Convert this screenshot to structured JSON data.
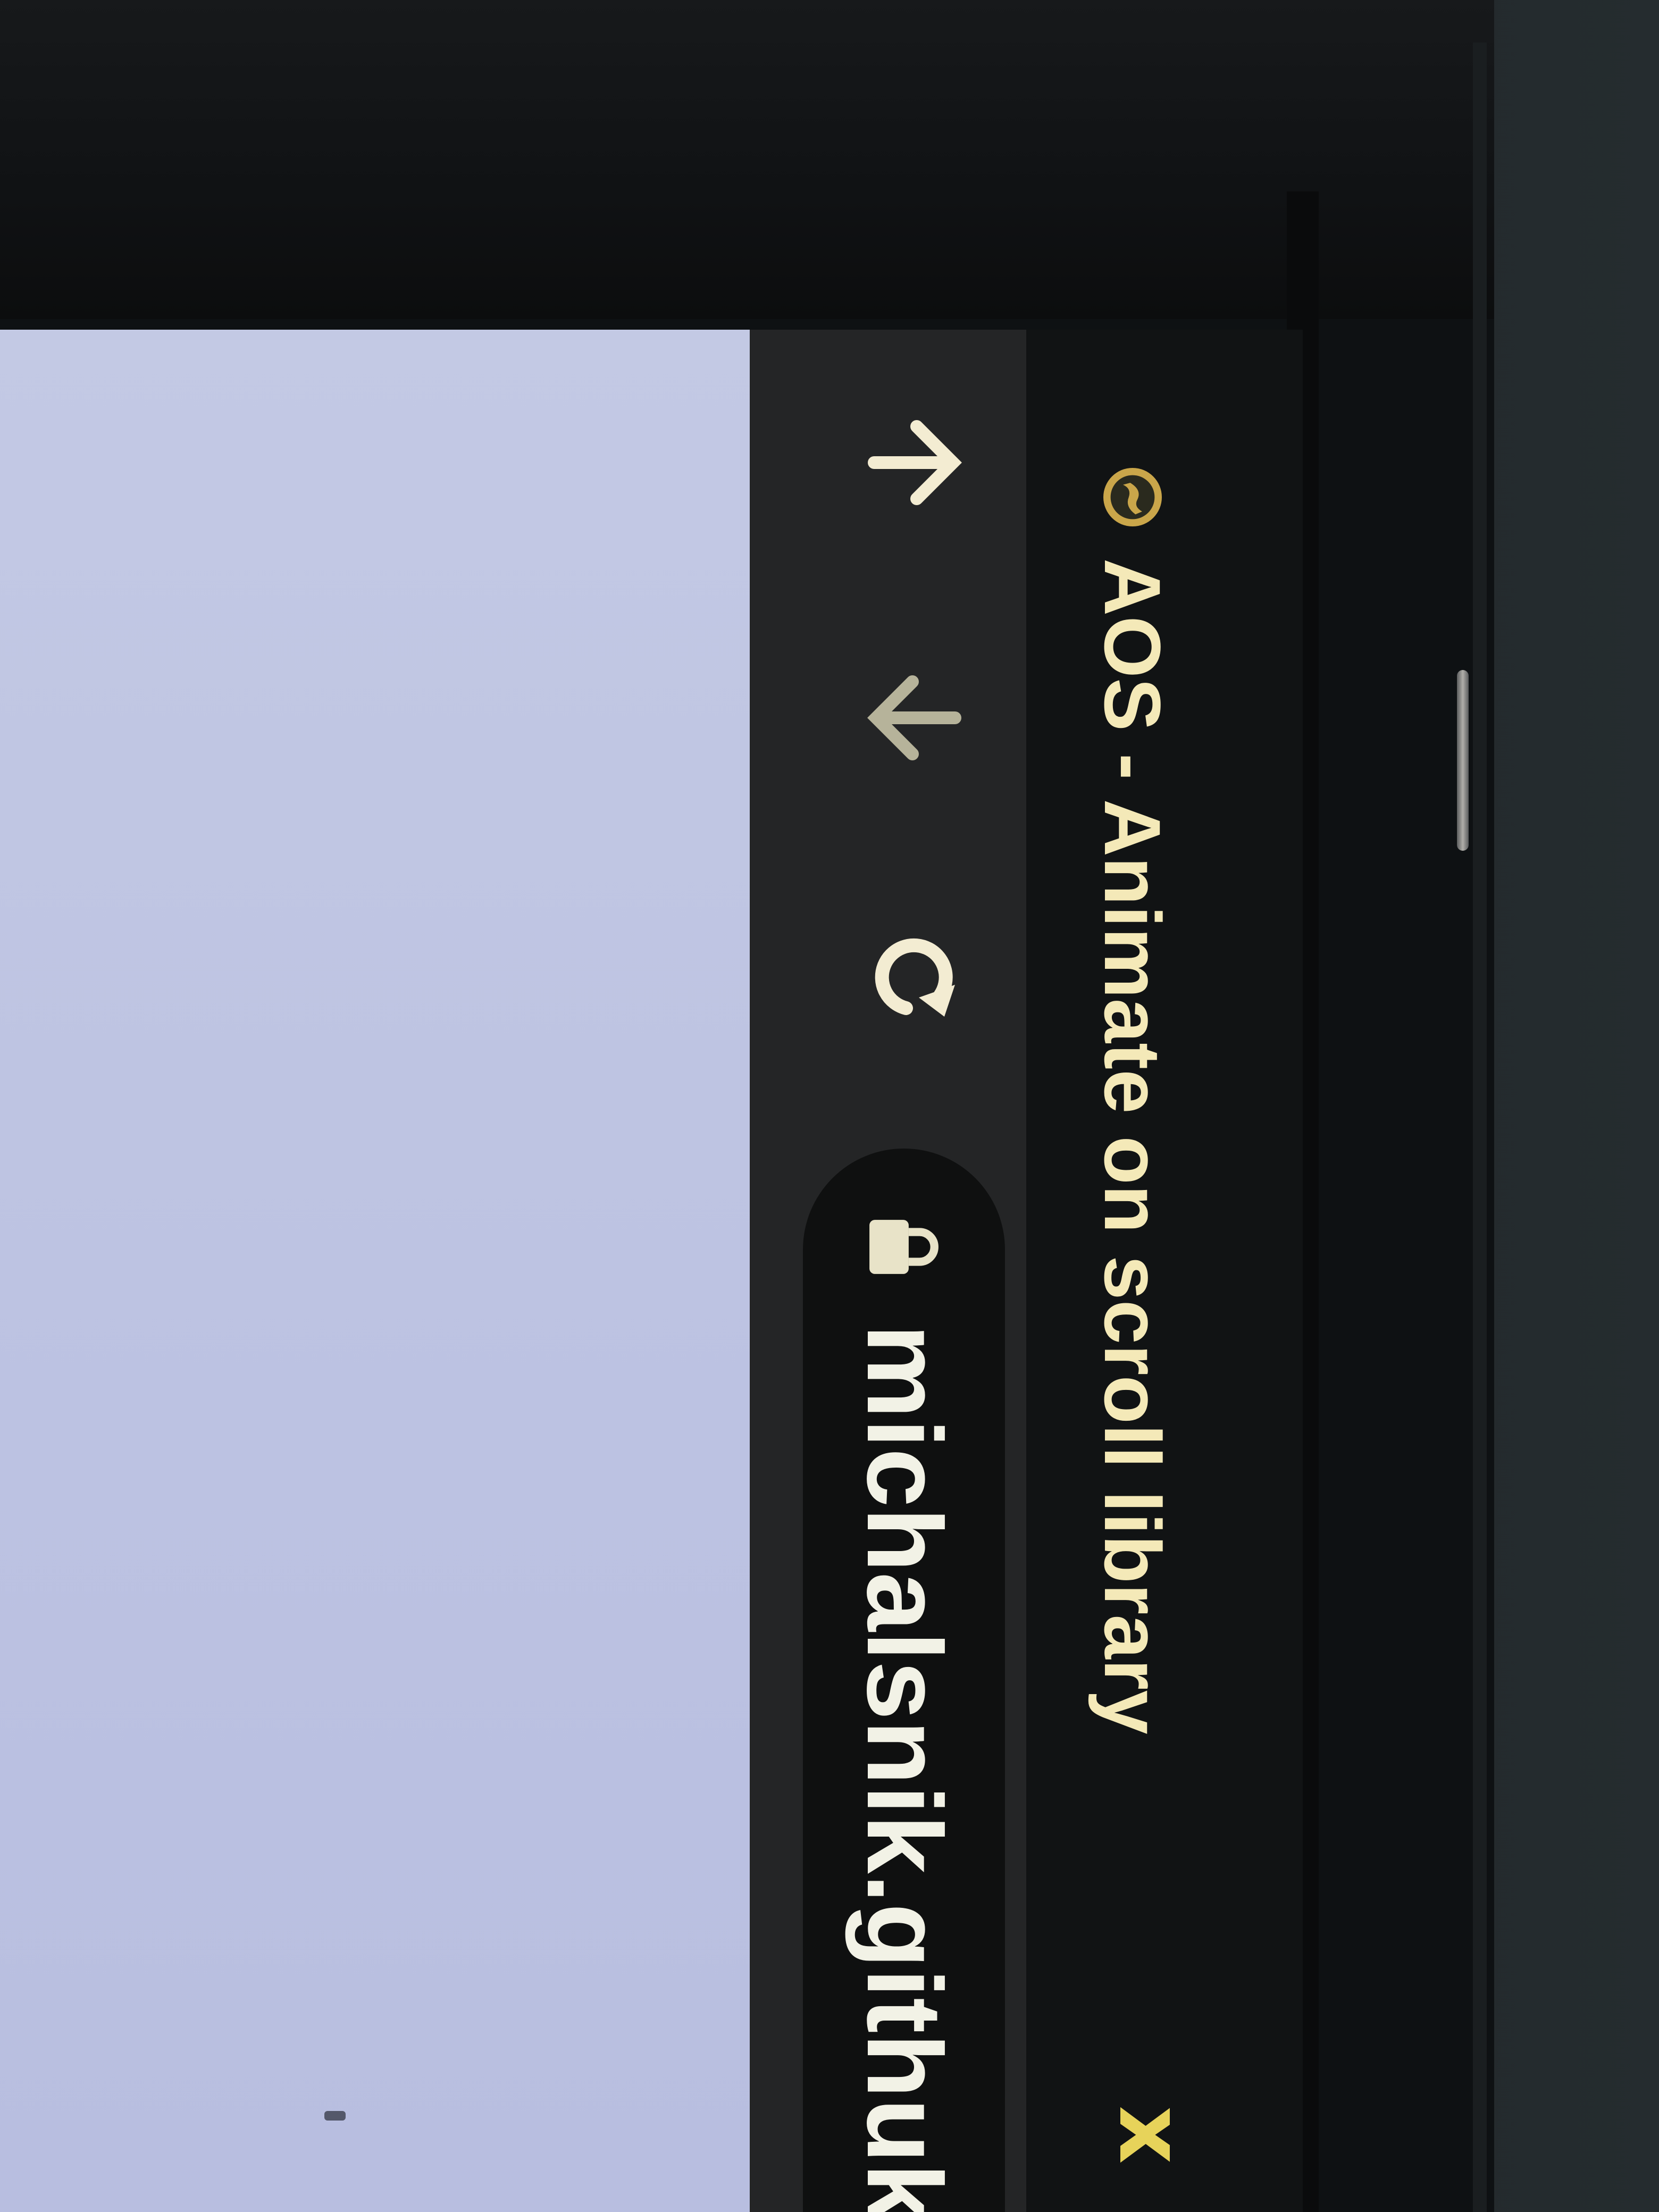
{
  "browser": {
    "tab": {
      "title": "AOS - Animate on scroll library",
      "favicon": "globe-icon",
      "close_glyph": "x"
    },
    "toolbar": {
      "back_icon": "arrow-up-icon",
      "forward_icon": "arrow-down-icon",
      "reload_icon": "reload-icon",
      "lock_icon": "lock-icon",
      "url": "michalsnik.githuk"
    }
  },
  "colors": {
    "tab_title": "#f4e9b8",
    "close": "#e7d35a",
    "favicon": "#caa64a",
    "page_background": "#bdc3e2"
  }
}
